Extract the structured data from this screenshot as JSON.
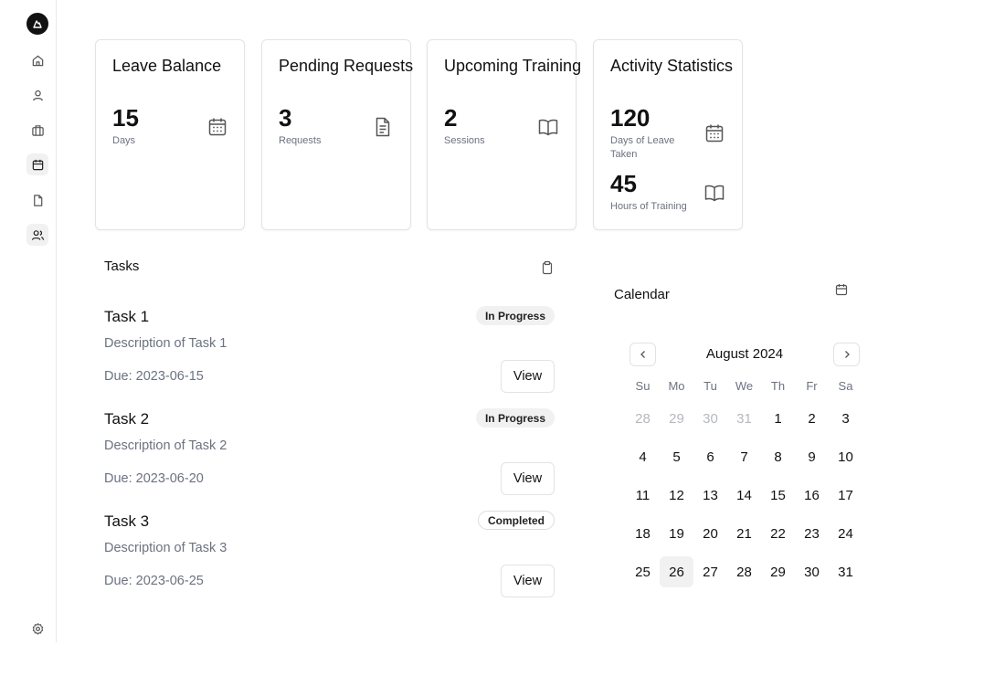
{
  "sidebar": {
    "items": [
      {
        "name": "home"
      },
      {
        "name": "profile"
      },
      {
        "name": "jobs"
      },
      {
        "name": "calendar"
      },
      {
        "name": "documents"
      },
      {
        "name": "team"
      }
    ],
    "active": "team"
  },
  "cards": {
    "leave": {
      "title": "Leave Balance",
      "value": "15",
      "label": "Days"
    },
    "pending": {
      "title": "Pending Requests",
      "value": "3",
      "label": "Requests"
    },
    "training": {
      "title": "Upcoming Training",
      "value": "2",
      "label": "Sessions"
    },
    "activity": {
      "title": "Activity Statistics",
      "leave_value": "120",
      "leave_label": "Days of Leave Taken",
      "training_value": "45",
      "training_label": "Hours of Training"
    }
  },
  "tasks": {
    "title": "Tasks",
    "items": [
      {
        "name": "Task 1",
        "description": "Description of Task 1",
        "due": "Due: 2023-06-15",
        "status": "In Progress",
        "action": "View"
      },
      {
        "name": "Task 2",
        "description": "Description of Task 2",
        "due": "Due: 2023-06-20",
        "status": "In Progress",
        "action": "View"
      },
      {
        "name": "Task 3",
        "description": "Description of Task 3",
        "due": "Due: 2023-06-25",
        "status": "Completed",
        "action": "View"
      }
    ]
  },
  "calendar": {
    "title": "Calendar",
    "month": "August 2024",
    "weekdays": [
      "Su",
      "Mo",
      "Tu",
      "We",
      "Th",
      "Fr",
      "Sa"
    ],
    "weeks": [
      [
        "28",
        "29",
        "30",
        "31",
        "1",
        "2",
        "3"
      ],
      [
        "4",
        "5",
        "6",
        "7",
        "8",
        "9",
        "10"
      ],
      [
        "11",
        "12",
        "13",
        "14",
        "15",
        "16",
        "17"
      ],
      [
        "18",
        "19",
        "20",
        "21",
        "22",
        "23",
        "24"
      ],
      [
        "25",
        "26",
        "27",
        "28",
        "29",
        "30",
        "31"
      ]
    ],
    "outside_days": [
      "28",
      "29",
      "30",
      "31"
    ],
    "selected": "26"
  }
}
